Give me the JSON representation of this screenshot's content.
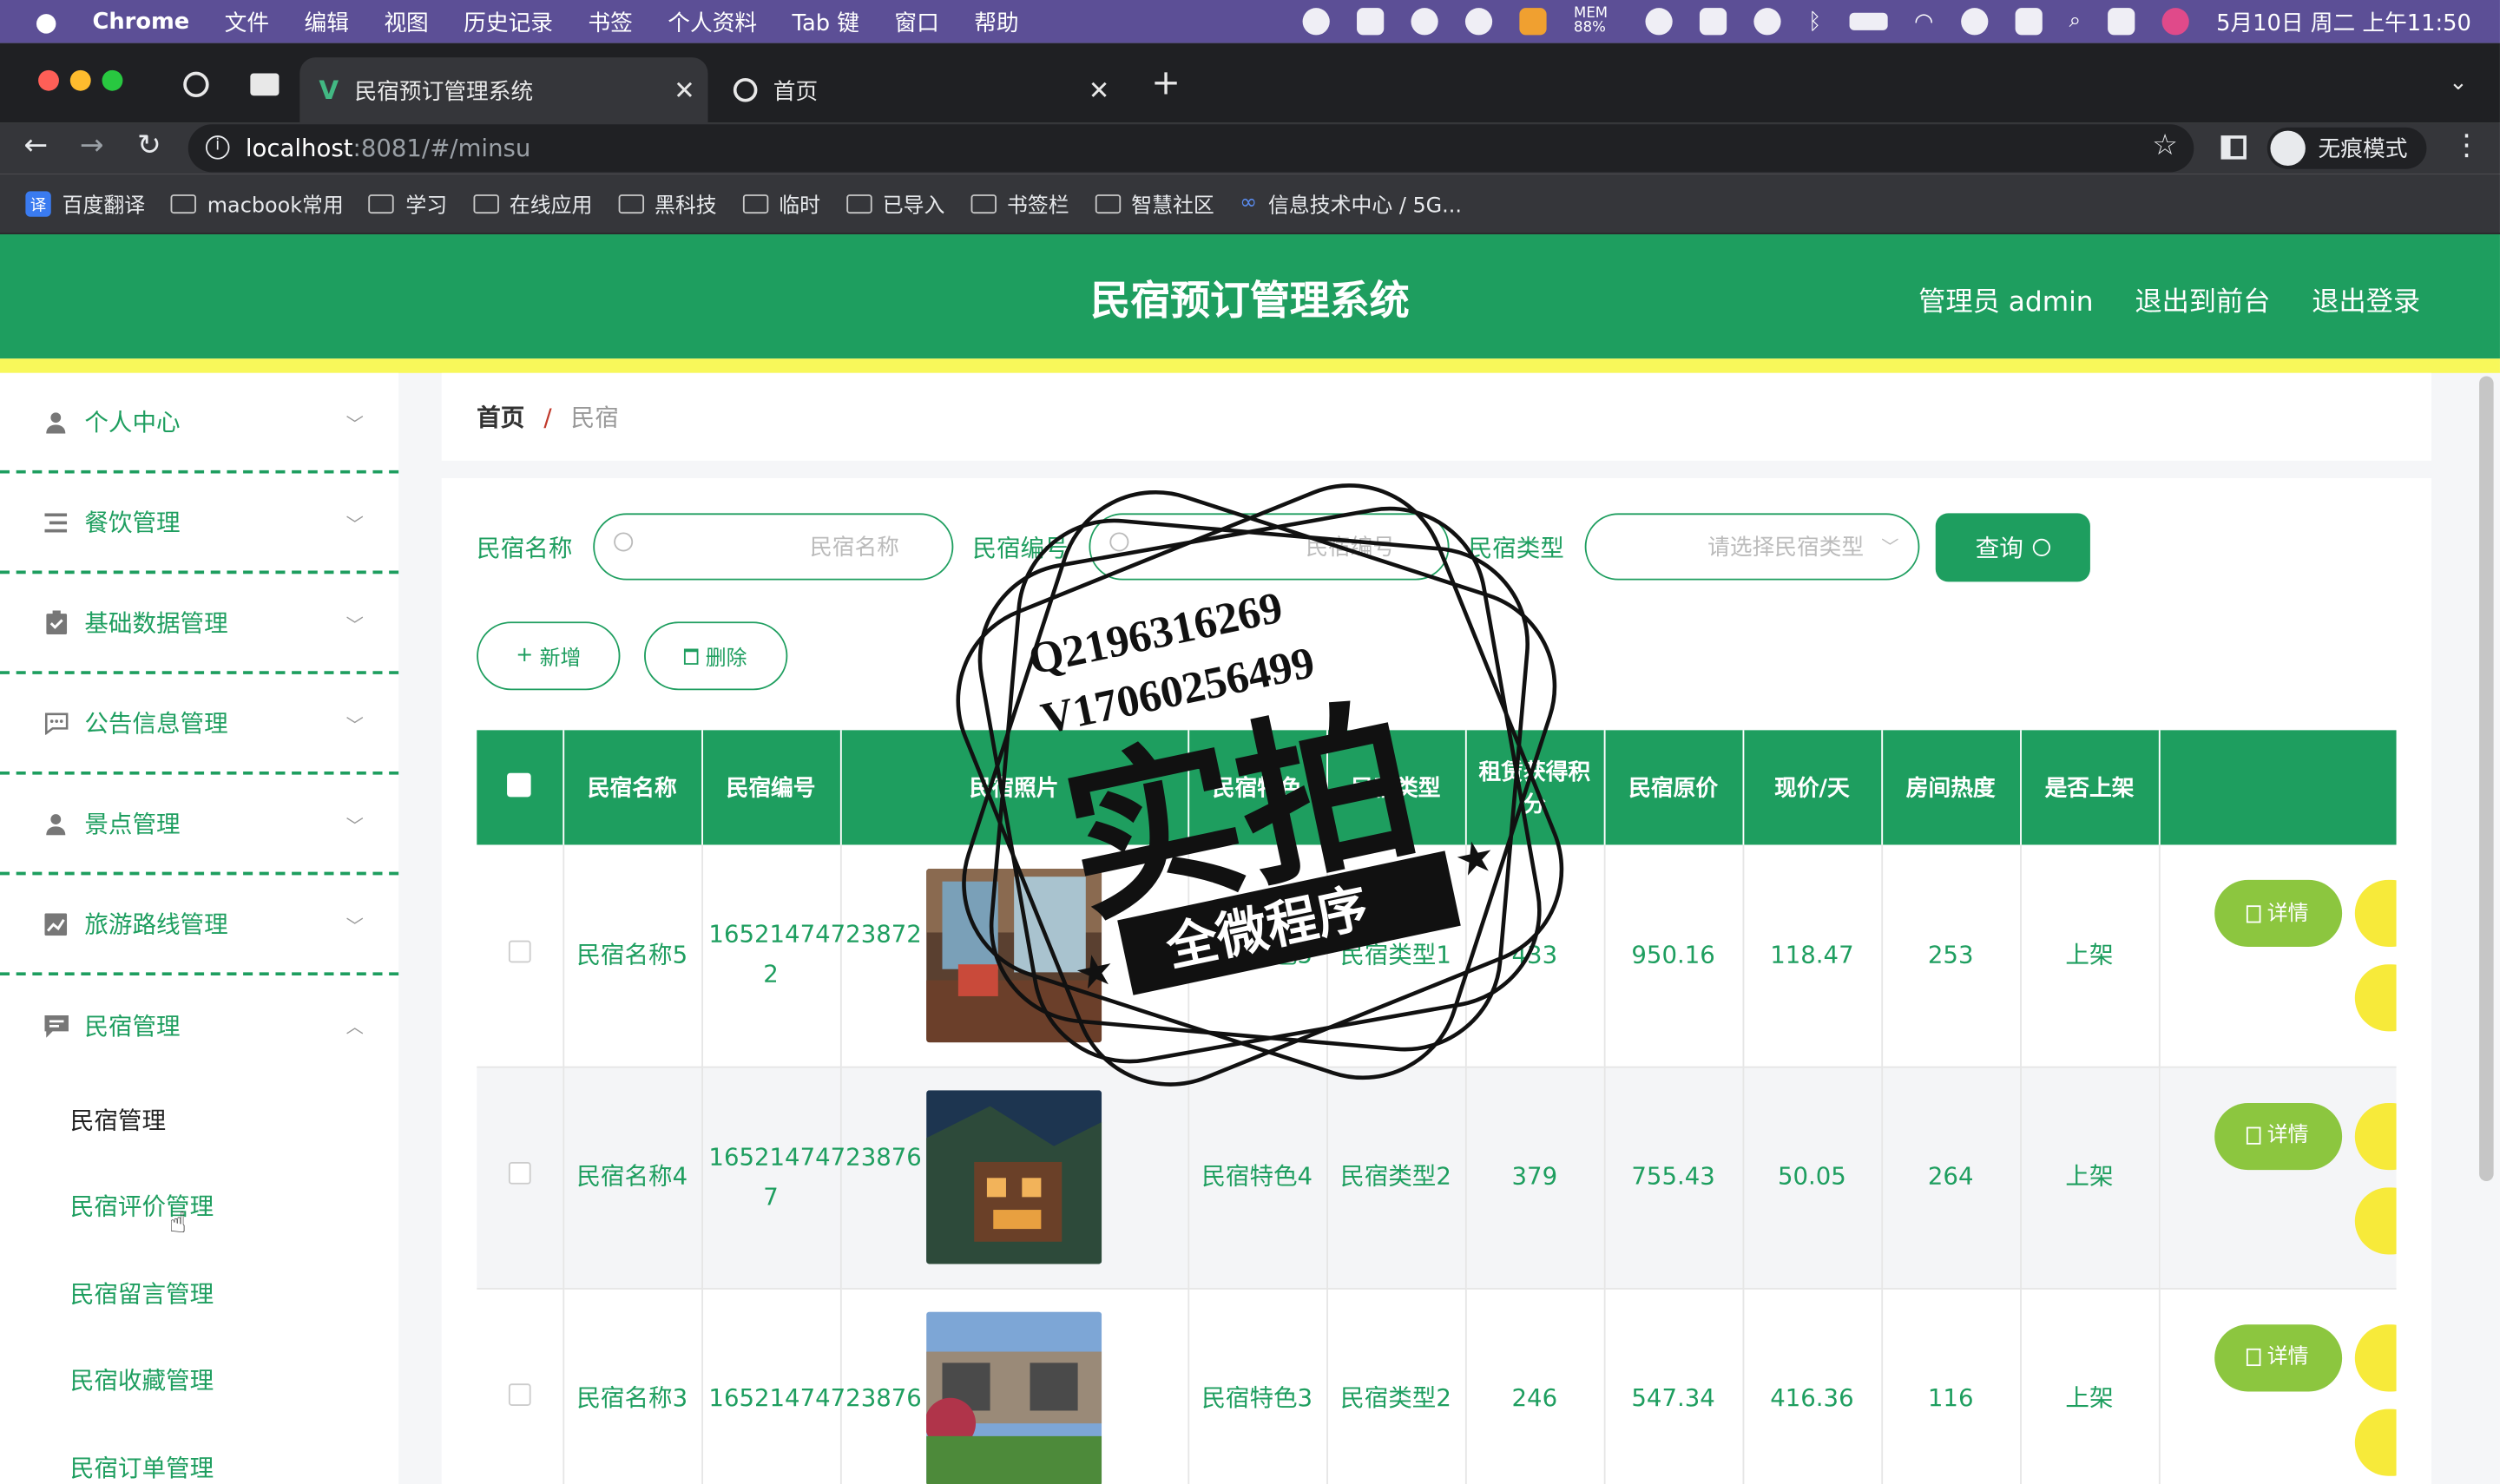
{
  "menubar": {
    "apple": "",
    "app": "Chrome",
    "items": [
      "文件",
      "编辑",
      "视图",
      "历史记录",
      "书签",
      "个人资料",
      "Tab 键",
      "窗口",
      "帮助"
    ],
    "mem": "MEM 88%",
    "datetime": "5月10日 周二 上午11:50"
  },
  "browser": {
    "tabs": [
      {
        "title": "民宿预订管理系统"
      },
      {
        "title": "首页"
      }
    ],
    "url_host": "localhost",
    "url_path": ":8081/#/minsu",
    "profile": "无痕模式",
    "bookmarks": [
      "百度翻译",
      "macbook常用",
      "学习",
      "在线应用",
      "黑科技",
      "临时",
      "已导入",
      "书签栏",
      "智慧社区",
      "信息技术中心 / 5G..."
    ]
  },
  "header": {
    "title": "民宿预订管理系统",
    "user": "管理员 admin",
    "front": "退出到前台",
    "logout": "退出登录"
  },
  "sidebar": {
    "menus": [
      {
        "label": "个人中心",
        "icon": "user-icon"
      },
      {
        "label": "餐饮管理",
        "icon": "list-icon"
      },
      {
        "label": "基础数据管理",
        "icon": "clipboard-icon"
      },
      {
        "label": "公告信息管理",
        "icon": "chat-icon"
      },
      {
        "label": "景点管理",
        "icon": "user-icon"
      },
      {
        "label": "旅游路线管理",
        "icon": "chart-icon"
      },
      {
        "label": "民宿管理",
        "icon": "message-icon"
      }
    ],
    "submenu": [
      "民宿管理",
      "民宿评价管理",
      "民宿留言管理",
      "民宿收藏管理",
      "民宿订单管理"
    ]
  },
  "breadcrumb": {
    "home": "首页",
    "sep": "/",
    "current": "民宿"
  },
  "search": {
    "name_label": "民宿名称",
    "name_placeholder": "民宿名称",
    "code_label": "民宿编号",
    "code_placeholder": "民宿编号",
    "type_label": "民宿类型",
    "type_placeholder": "请选择民宿类型",
    "query": "查询"
  },
  "actions": {
    "add": "新增",
    "delete": "删除",
    "detail": "详情"
  },
  "table": {
    "headers": [
      "民宿名称",
      "民宿编号",
      "民宿照片",
      "民宿特色",
      "民宿类型",
      "租赁获得积分",
      "民宿原价",
      "现价/天",
      "房间热度",
      "是否上架"
    ],
    "rows": [
      {
        "name": "民宿名称5",
        "code": "16521474723872 2",
        "feature": "民宿特色5",
        "type": "民宿类型1",
        "points": "433",
        "orig": "950.16",
        "price": "118.47",
        "heat": "253",
        "status": "上架"
      },
      {
        "name": "民宿名称4",
        "code": "16521474723876 7",
        "feature": "民宿特色4",
        "type": "民宿类型2",
        "points": "379",
        "orig": "755.43",
        "price": "50.05",
        "heat": "264",
        "status": "上架"
      },
      {
        "name": "民宿名称3",
        "code": "16521474723876",
        "feature": "民宿特色3",
        "type": "民宿类型2",
        "points": "246",
        "orig": "547.34",
        "price": "416.36",
        "heat": "116",
        "status": "上架"
      }
    ]
  },
  "watermark": {
    "line1": "Q2196316269",
    "line2": "V17060256499",
    "big": "实拍",
    "band": "全微程序"
  },
  "colors": {
    "primary": "#1e9e5f",
    "accent_yellow": "#f8f85a",
    "detail_btn": "#8cc63f"
  }
}
